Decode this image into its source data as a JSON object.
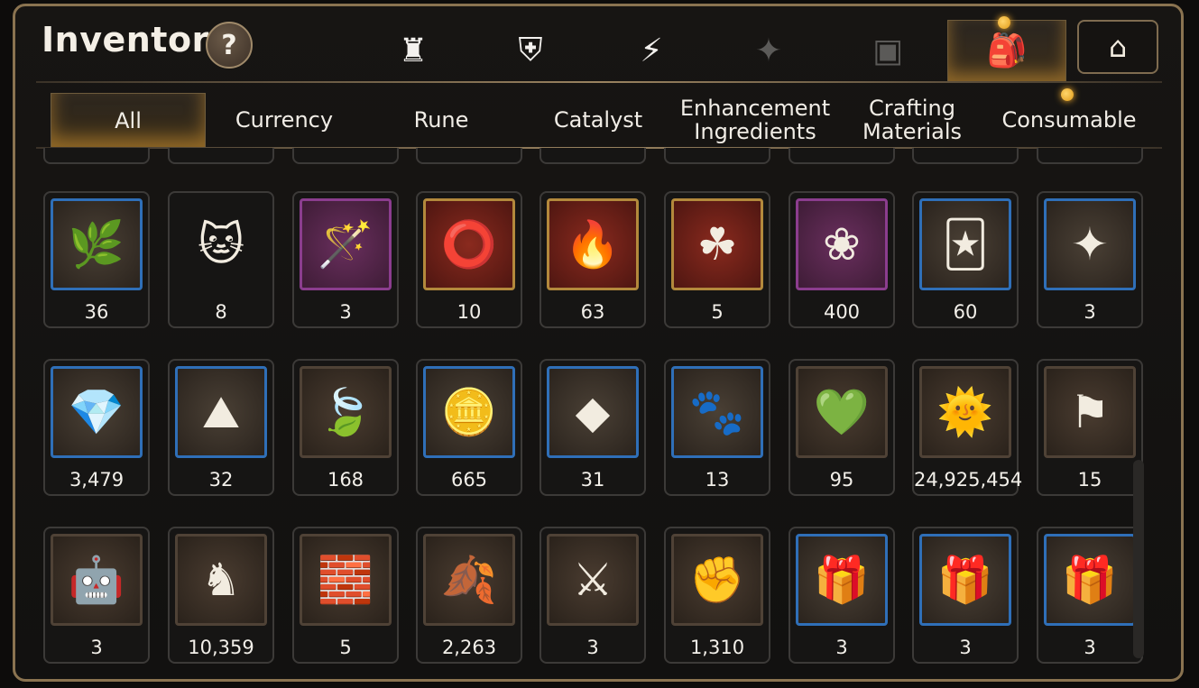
{
  "header": {
    "title": "Inventory",
    "help_label": "?"
  },
  "top_tabs": [
    {
      "icon": "knight-shield-icon",
      "glyph": "♜"
    },
    {
      "icon": "broken-shield-icon",
      "glyph": "⛨"
    },
    {
      "icon": "lightning-icon",
      "glyph": "⚡"
    },
    {
      "icon": "star-emblem-icon",
      "glyph": "✦"
    },
    {
      "icon": "cube-icon",
      "glyph": "▣"
    },
    {
      "icon": "backpack-icon",
      "glyph": "🎒"
    },
    {
      "icon": "guild-house-icon",
      "glyph": "⌂"
    }
  ],
  "sub_tabs": [
    {
      "label": "All",
      "active": true
    },
    {
      "label": "Currency"
    },
    {
      "label": "Rune"
    },
    {
      "label": "Catalyst"
    },
    {
      "label": "Enhancement Ingredients"
    },
    {
      "label": "Crafting Materials"
    },
    {
      "label": "Consumable"
    }
  ],
  "items": [
    {
      "icon": "ginseng-root-icon",
      "glyph": "🌿",
      "frame": "blue",
      "count": "36"
    },
    {
      "icon": "pet-food-bag-icon",
      "glyph": "🐱",
      "frame": "hex",
      "count": "8"
    },
    {
      "icon": "feather-wand-icon",
      "glyph": "🪄",
      "frame": "purple",
      "count": "3"
    },
    {
      "icon": "blue-ring-icon",
      "glyph": "⭕",
      "frame": "gold",
      "count": "10"
    },
    {
      "icon": "fire-crystal-icon",
      "glyph": "🔥",
      "frame": "gold",
      "count": "63"
    },
    {
      "icon": "clover-pendant-icon",
      "glyph": "☘",
      "frame": "gold",
      "count": "5"
    },
    {
      "icon": "red-flower-ring-icon",
      "glyph": "❀",
      "frame": "purple",
      "count": "400"
    },
    {
      "icon": "costume-card-icon",
      "glyph": "🃏",
      "frame": "blue",
      "count": "60"
    },
    {
      "icon": "star-pendant-icon",
      "glyph": "✦",
      "frame": "blue",
      "count": "3"
    },
    {
      "icon": "blue-gem-icon",
      "glyph": "💎",
      "frame": "blue",
      "count": "3,479"
    },
    {
      "icon": "pink-crystal-pile-icon",
      "glyph": "⛰",
      "frame": "blue",
      "count": "32"
    },
    {
      "icon": "green-leaf-icon",
      "glyph": "🍃",
      "frame": "brown",
      "count": "168"
    },
    {
      "icon": "silver-coin-icon",
      "glyph": "🪙",
      "frame": "blue",
      "count": "665"
    },
    {
      "icon": "cyan-crystal-icon",
      "glyph": "◆",
      "frame": "blue",
      "count": "31"
    },
    {
      "icon": "paw-card-icon",
      "glyph": "🐾",
      "frame": "blue",
      "count": "13"
    },
    {
      "icon": "green-heart-icon",
      "glyph": "💚",
      "frame": "brown",
      "count": "95"
    },
    {
      "icon": "gold-coin-icon",
      "glyph": "🌞",
      "frame": "brown",
      "count": "24,925,454"
    },
    {
      "icon": "banner-flag-icon",
      "glyph": "⚑",
      "frame": "brown",
      "count": "15"
    },
    {
      "icon": "robot-pod-icon",
      "glyph": "🤖",
      "frame": "brown",
      "count": "3"
    },
    {
      "icon": "chess-knight-icon",
      "glyph": "♞",
      "frame": "brown",
      "count": "10,359"
    },
    {
      "icon": "stone-block-icon",
      "glyph": "🧱",
      "frame": "brown",
      "count": "5"
    },
    {
      "icon": "red-leaves-icon",
      "glyph": "🍂",
      "frame": "brown",
      "count": "2,263"
    },
    {
      "icon": "red-badge-icon",
      "glyph": "⚔",
      "frame": "brown",
      "count": "3"
    },
    {
      "icon": "fist-emblem-icon",
      "glyph": "✊",
      "frame": "brown",
      "count": "1,310"
    },
    {
      "icon": "red-gem-chest-icon",
      "glyph": "🎁",
      "frame": "blue",
      "count": "3"
    },
    {
      "icon": "blue-gem-chest-icon",
      "glyph": "🎁",
      "frame": "blue",
      "count": "3"
    },
    {
      "icon": "green-gem-chest-icon",
      "glyph": "🎁",
      "frame": "blue",
      "count": "3"
    }
  ],
  "colors": {
    "accent_gold": "#e0a040",
    "frame_border": "#8a7350"
  }
}
